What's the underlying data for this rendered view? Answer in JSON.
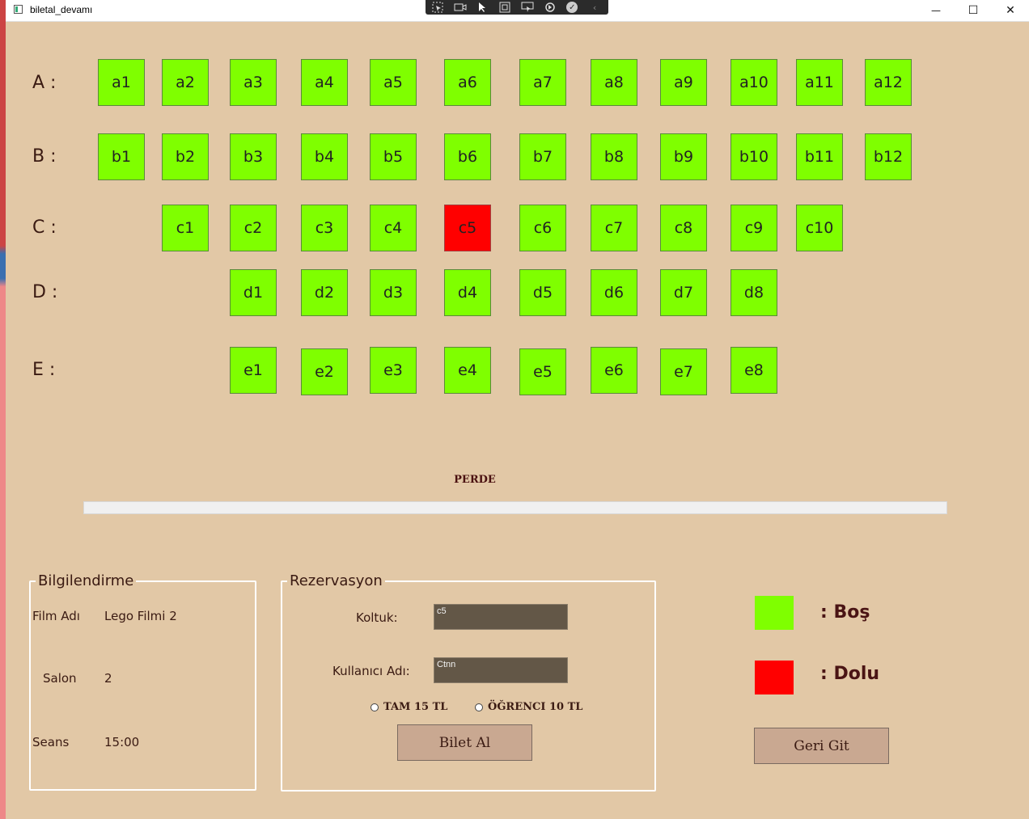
{
  "window": {
    "title": "biletal_devamı",
    "controls": {
      "minimize": "—",
      "maximize": "☐",
      "close": "✕"
    }
  },
  "toolbar": {
    "icons": [
      "select-icon",
      "record-icon",
      "pointer-icon",
      "frame-icon",
      "layout-icon",
      "hotreload-icon",
      "check-icon",
      "collapse-icon"
    ]
  },
  "seating": {
    "rows": [
      {
        "label": "A :",
        "seats": [
          "a1",
          "a2",
          "a3",
          "a4",
          "a5",
          "a6",
          "a7",
          "a8",
          "a9",
          "a10",
          "a11",
          "a12"
        ]
      },
      {
        "label": "B :",
        "seats": [
          "b1",
          "b2",
          "b3",
          "b4",
          "b5",
          "b6",
          "b7",
          "b8",
          "b9",
          "b10",
          "b11",
          "b12"
        ]
      },
      {
        "label": "C :",
        "seats": [
          "c1",
          "c2",
          "c3",
          "c4",
          "c5",
          "c6",
          "c7",
          "c8",
          "c9",
          "c10"
        ]
      },
      {
        "label": "D :",
        "seats": [
          "d1",
          "d2",
          "d3",
          "d4",
          "d5",
          "d6",
          "d7",
          "d8"
        ]
      },
      {
        "label": "E :",
        "seats": [
          "e1",
          "e2",
          "e3",
          "e4",
          "e5",
          "e6",
          "e7",
          "e8"
        ]
      }
    ],
    "occupied": [
      "c5"
    ],
    "screen_label": "PERDE",
    "colors": {
      "bos": "#7fff00",
      "dolu": "#ff0000"
    }
  },
  "info": {
    "title": "Bilgilendirme",
    "film_label": "Film Adı",
    "film_value": "Lego Filmi 2",
    "salon_label": "Salon",
    "salon_value": "2",
    "seans_label": "Seans",
    "seans_value": "15:00"
  },
  "reservation": {
    "title": "Rezervasyon",
    "seat_label": "Koltuk:",
    "seat_value": "c5",
    "user_label": "Kullanıcı Adı:",
    "user_value": "Ctnn",
    "radio_full": "TAM 15 TL",
    "radio_student": "ÖĞRENCI 10 TL",
    "buy_button": "Bilet Al"
  },
  "legend": {
    "bos_label": ": Boş",
    "dolu_label": ": Dolu"
  },
  "back_button": "Geri Git"
}
